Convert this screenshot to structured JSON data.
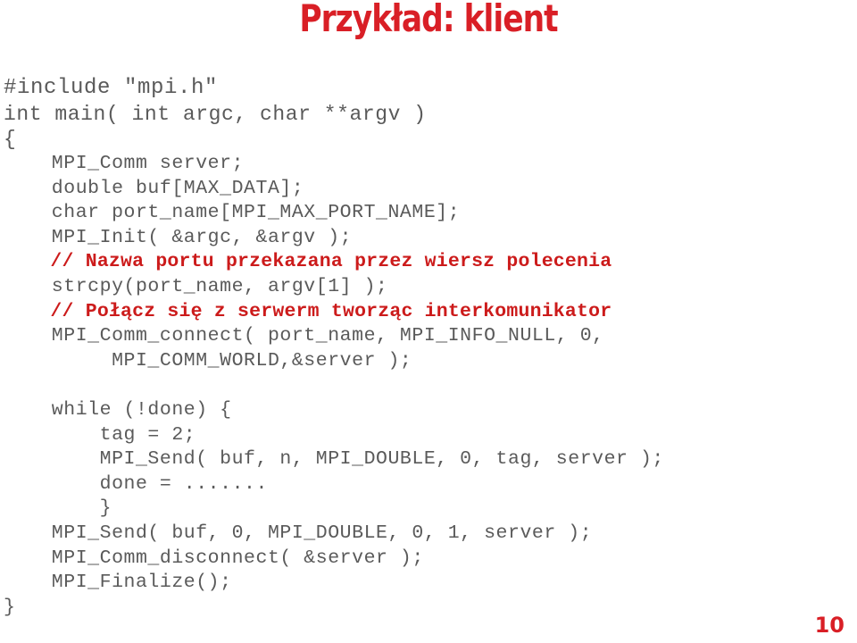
{
  "slide": {
    "title": "Przykład: klient",
    "title_color": "#d91f26",
    "background_color": "#ffffff",
    "page_number": "10",
    "page_number_color": "#d91f26",
    "code_color": "#5a5a5a",
    "comment_color": "#cc1b1b"
  },
  "code": {
    "language": "c",
    "lines": [
      {
        "text": "#include \"mpi.h\"",
        "kind": "code",
        "size": "lg"
      },
      {
        "text": "int main( int argc, char **argv )",
        "kind": "code",
        "size": "lg2"
      },
      {
        "text": "{",
        "kind": "code",
        "size": "lg2"
      },
      {
        "text": "    MPI_Comm server;",
        "kind": "code",
        "size": "md"
      },
      {
        "text": "    double buf[MAX_DATA];",
        "kind": "code",
        "size": "md"
      },
      {
        "text": "    char port_name[MPI_MAX_PORT_NAME];",
        "kind": "code",
        "size": "md"
      },
      {
        "text": "    MPI_Init( &argc, &argv );",
        "kind": "code",
        "size": "md"
      },
      {
        "text": "    // Nazwa portu przekazana przez wiersz polecenia",
        "kind": "comment",
        "size": "md"
      },
      {
        "text": "    strcpy(port_name, argv[1] );",
        "kind": "code",
        "size": "md"
      },
      {
        "text": "    // Połącz się z serwerm tworząc interkomunikator",
        "kind": "comment",
        "size": "md"
      },
      {
        "text": "    MPI_Comm_connect( port_name, MPI_INFO_NULL, 0,",
        "kind": "code",
        "size": "md"
      },
      {
        "text": "         MPI_COMM_WORLD,&server );",
        "kind": "code",
        "size": "md"
      },
      {
        "text": "",
        "kind": "blank",
        "size": "md"
      },
      {
        "text": "    while (!done) {",
        "kind": "code",
        "size": "md"
      },
      {
        "text": "        tag = 2;",
        "kind": "code",
        "size": "md"
      },
      {
        "text": "        MPI_Send( buf, n, MPI_DOUBLE, 0, tag, server );",
        "kind": "code",
        "size": "md"
      },
      {
        "text": "        done = .......",
        "kind": "code",
        "size": "md"
      },
      {
        "text": "        }",
        "kind": "code",
        "size": "md"
      },
      {
        "text": "    MPI_Send( buf, 0, MPI_DOUBLE, 0, 1, server );",
        "kind": "code",
        "size": "md"
      },
      {
        "text": "    MPI_Comm_disconnect( &server );",
        "kind": "code",
        "size": "md"
      },
      {
        "text": "    MPI_Finalize();",
        "kind": "code",
        "size": "md"
      },
      {
        "text": "}",
        "kind": "code",
        "size": "md"
      }
    ]
  }
}
